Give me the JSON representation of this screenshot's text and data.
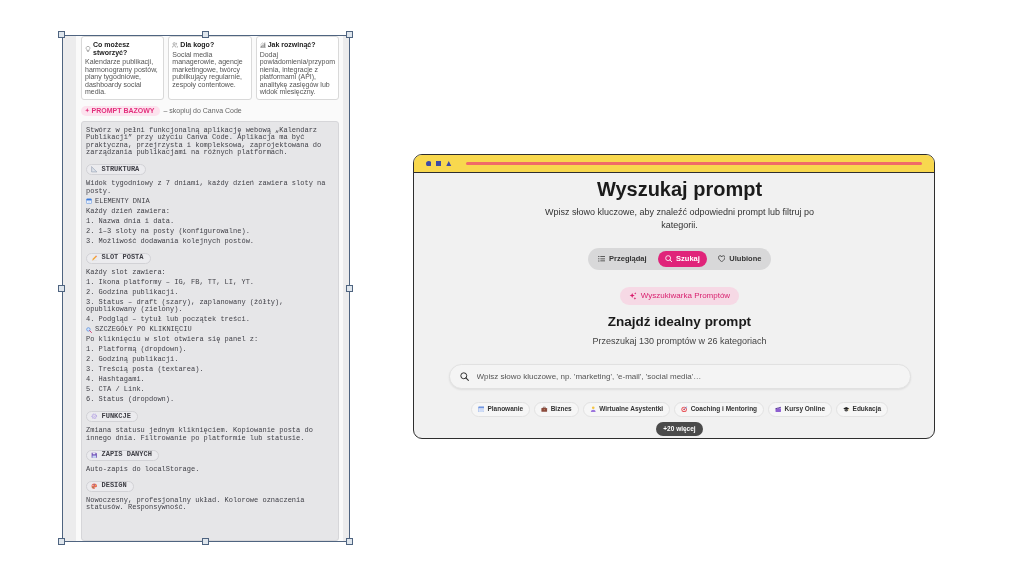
{
  "document_preview": {
    "cards": [
      {
        "title": "Co możesz stworzyć?",
        "text": "Kalendarze publikacji, harmonogramy postów, plany tygodniowe, dashboardy social media."
      },
      {
        "title": "Dla kogo?",
        "text": "Social media managerowie, agencje marketingowe, twórcy publikujący regularnie, zespoły contentowe."
      },
      {
        "title": "Jak rozwinąć?",
        "text": "Dodaj powiadomienia/przypomnienia, integracje z platformami (API), analitykę zasięgów lub widok miesięczny."
      }
    ],
    "badge": {
      "label": "PROMPT BAZOWY",
      "note": "– skopiuj do Canva Code"
    },
    "prompt_blocks": [
      {
        "kind": "paragraph",
        "text": "Stwórz w pełni funkcjonalną aplikację webową „Kalendarz Publikacji” przy użyciu Canva Code. Aplikacja ma być praktyczna, przejrzysta i kompleksowa, zaprojektowana do zarządzania publikacjami na różnych platformach."
      },
      {
        "kind": "pill",
        "text": "STRUKTURA"
      },
      {
        "kind": "paragraph",
        "text": "Widok tygodniowy z 7 dniami, każdy dzień zawiera sloty na posty."
      },
      {
        "kind": "heading",
        "text": "ELEMENTY DNIA"
      },
      {
        "kind": "paragraph",
        "text": "Każdy dzień zawiera:"
      },
      {
        "kind": "paragraph",
        "text": "1. Nazwa dnia i data."
      },
      {
        "kind": "paragraph",
        "text": "2. 1–3 sloty na posty (konfigurowalne)."
      },
      {
        "kind": "paragraph",
        "text": "3. Możliwość dodawania kolejnych postów."
      },
      {
        "kind": "pill",
        "text": "SLOT POSTA"
      },
      {
        "kind": "paragraph",
        "text": "Każdy slot zawiera:"
      },
      {
        "kind": "paragraph",
        "text": "1. Ikona platformy – IG, FB, TT, LI, YT."
      },
      {
        "kind": "paragraph",
        "text": "2. Godzina publikacji."
      },
      {
        "kind": "paragraph",
        "text": "3. Status – draft (szary), zaplanowany (żółty), opublikowany (zielony)."
      },
      {
        "kind": "paragraph",
        "text": "4. Podgląd – tytuł lub początek treści."
      },
      {
        "kind": "heading",
        "text": "SZCZEGÓŁY PO KLIKNIĘCIU"
      },
      {
        "kind": "paragraph",
        "text": "Po kliknięciu w slot otwiera się panel z:"
      },
      {
        "kind": "paragraph",
        "text": "1. Platformą (dropdown)."
      },
      {
        "kind": "paragraph",
        "text": "2. Godziną publikacji."
      },
      {
        "kind": "paragraph",
        "text": "3. Treścią posta (textarea)."
      },
      {
        "kind": "paragraph",
        "text": "4. Hashtagami."
      },
      {
        "kind": "paragraph",
        "text": "5. CTA / Link."
      },
      {
        "kind": "paragraph",
        "text": "6. Status (dropdown)."
      },
      {
        "kind": "pill",
        "text": "FUNKCJE"
      },
      {
        "kind": "paragraph",
        "text": "Zmiana statusu jednym kliknięciem. Kopiowanie posta do innego dnia. Filtrowanie po platformie lub statusie."
      },
      {
        "kind": "pill",
        "text": "ZAPIS DANYCH"
      },
      {
        "kind": "paragraph",
        "text": "Auto-zapis do localStorage."
      },
      {
        "kind": "pill",
        "text": "DESIGN"
      },
      {
        "kind": "paragraph",
        "text": "Nowoczesny, profesjonalny układ. Kolorowe oznaczenia statusów. Responsywność."
      }
    ]
  },
  "app_window": {
    "title": "Wyszukaj prompt",
    "subtitle": "Wpisz słowo kluczowe, aby znaleźć odpowiedni prompt lub filtruj po kategorii.",
    "tabs": [
      {
        "label": "Przeglądaj",
        "selected": false
      },
      {
        "label": "Szukaj",
        "selected": true
      },
      {
        "label": "Ulubione",
        "selected": false
      }
    ],
    "badge": "Wyszukiwarka Promptów",
    "heading": "Znajdź idealny prompt",
    "summary": "Przeszukaj 130 promptów w 26 kategoriach",
    "search": {
      "placeholder": "Wpisz słowo kluczowe, np. 'marketing', 'e-mail', 'social media'…"
    },
    "categories": [
      "Planowanie",
      "Biznes",
      "Wirtualne Asystentki",
      "Coaching i Mentoring",
      "Kursy Online",
      "Edukacja"
    ],
    "more_button": "+20 więcej"
  }
}
